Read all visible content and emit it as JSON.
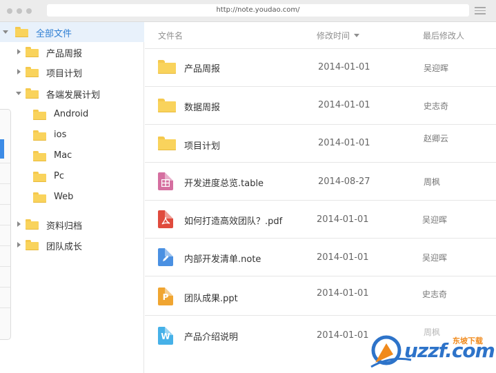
{
  "browser": {
    "url": "http://note.youdao.com/"
  },
  "sidebar": {
    "root": {
      "label": "全部文件"
    },
    "items": [
      {
        "label": "产品周报"
      },
      {
        "label": "项目计划"
      },
      {
        "label": "各端发展计划"
      },
      {
        "label": "Android"
      },
      {
        "label": "ios"
      },
      {
        "label": "Mac"
      },
      {
        "label": "Pc"
      },
      {
        "label": "Web"
      },
      {
        "label": "资料归档"
      },
      {
        "label": "团队成长"
      }
    ]
  },
  "list": {
    "columns": {
      "name": "文件名",
      "modified": "修改时间",
      "editor": "最后修改人"
    },
    "rows": [
      {
        "name": "产品周报",
        "date": "2014-01-01",
        "user": "吴迎晖",
        "icon": "folder-icon"
      },
      {
        "name": "数据周报",
        "date": "2014-01-01",
        "user": "史志奇",
        "icon": "folder-icon"
      },
      {
        "name": "项目计划",
        "date": "2014-01-01",
        "user": "赵卿云",
        "icon": "folder-icon"
      },
      {
        "name": "开发进度总览.table",
        "date": "2014-08-27",
        "user": "周枫",
        "icon": "table-file-icon"
      },
      {
        "name": "如何打造高效团队？.pdf",
        "date": "2014-01-01",
        "user": "吴迎晖",
        "icon": "pdf-file-icon"
      },
      {
        "name": "内部开发清单.note",
        "date": "2014-01-01",
        "user": "吴迎晖",
        "icon": "note-file-icon"
      },
      {
        "name": "团队成果.ppt",
        "date": "2014-01-01",
        "user": "史志奇",
        "icon": "ppt-file-icon"
      },
      {
        "name": "产品介绍说明",
        "date": "2014-01-01",
        "user": "周枫",
        "icon": "word-file-icon"
      }
    ]
  },
  "watermark": {
    "brand": "uzzf.com",
    "tagline": "东坡下载"
  },
  "colors": {
    "accent": "#2f7fd3",
    "folder": "#f9d35c",
    "table": "#d56fa0",
    "pdf": "#e04b3d",
    "note": "#4a90e2",
    "ppt": "#f0a531",
    "word": "#46b1e8"
  }
}
